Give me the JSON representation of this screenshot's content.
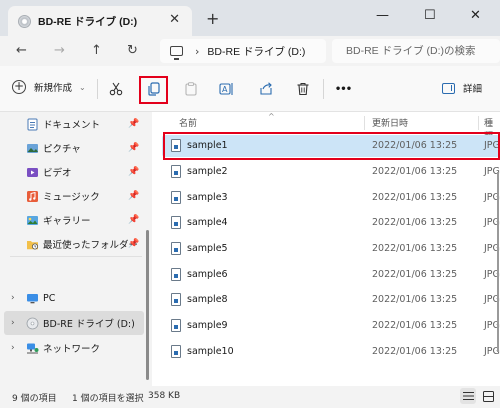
{
  "tab": {
    "title": "BD-RE ドライブ (D:)",
    "close": "✕",
    "new_tab": "+"
  },
  "window_controls": {
    "minimize": "—",
    "maximize": "☐",
    "close": "✕"
  },
  "nav_buttons": {
    "back": "←",
    "forward": "→",
    "up": "↑",
    "refresh": "↻"
  },
  "address": {
    "chevron": "›",
    "path": "BD-RE ドライブ (D:)"
  },
  "search": {
    "placeholder": "BD-RE ドライブ (D:)の検索"
  },
  "toolbar": {
    "new_label": "新規作成",
    "new_dropdown": "⌄",
    "more": "•••",
    "detail_label": "詳細",
    "highlight_color": "#e3001b"
  },
  "sidebar": {
    "items": [
      {
        "label": "ドキュメント",
        "icon": "documents-icon",
        "pinned": true
      },
      {
        "label": "ピクチャ",
        "icon": "pictures-icon",
        "pinned": true
      },
      {
        "label": "ビデオ",
        "icon": "videos-icon",
        "pinned": true
      },
      {
        "label": "ミュージック",
        "icon": "music-icon",
        "pinned": true
      },
      {
        "label": "ギャラリー",
        "icon": "gallery-icon",
        "pinned": true
      },
      {
        "label": "最近使ったフォルダー",
        "icon": "recent-folder-icon",
        "pinned": true
      }
    ],
    "tree": [
      {
        "label": "PC",
        "icon": "pc-icon",
        "expander": "›"
      },
      {
        "label": "BD-RE ドライブ (D:)",
        "icon": "disc-drive-icon",
        "expander": "›",
        "selected": true
      },
      {
        "label": "ネットワーク",
        "icon": "network-icon",
        "expander": "›"
      }
    ],
    "pin_glyph": "📌"
  },
  "columns": {
    "name": "名前",
    "date": "更新日時",
    "type": "種類",
    "sort_caret": "^"
  },
  "files": [
    {
      "name": "sample1",
      "date": "2022/01/06 13:25",
      "type": "JPG"
    },
    {
      "name": "sample2",
      "date": "2022/01/06 13:25",
      "type": "JPG"
    },
    {
      "name": "sample3",
      "date": "2022/01/06 13:25",
      "type": "JPG"
    },
    {
      "name": "sample4",
      "date": "2022/01/06 13:25",
      "type": "JPG"
    },
    {
      "name": "sample5",
      "date": "2022/01/06 13:25",
      "type": "JPG"
    },
    {
      "name": "sample6",
      "date": "2022/01/06 13:25",
      "type": "JPG"
    },
    {
      "name": "sample8",
      "date": "2022/01/06 13:25",
      "type": "JPG"
    },
    {
      "name": "sample9",
      "date": "2022/01/06 13:25",
      "type": "JPG"
    },
    {
      "name": "sample10",
      "date": "2022/01/06 13:25",
      "type": "JPG"
    }
  ],
  "status": {
    "count": "9 個の項目",
    "selection": "1 個の項目を選択",
    "size": "358 KB"
  },
  "colors": {
    "accent": "#2b6cb0",
    "selection": "#cce4f7",
    "highlight": "#e3001b"
  }
}
